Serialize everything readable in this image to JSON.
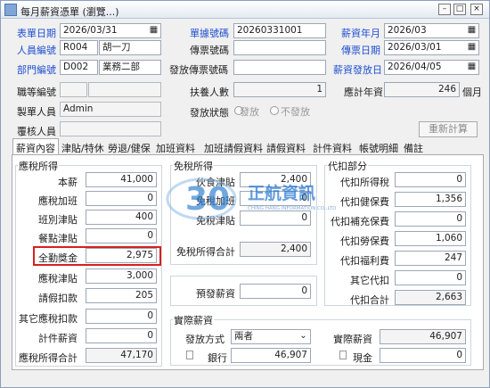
{
  "window": {
    "title": "每月薪資憑單 (瀏覽...)",
    "min": "–",
    "max": "□",
    "close": "×"
  },
  "header": {
    "date_label": "表單日期",
    "date_value": "2026/03/31",
    "voucher_label": "單據號碼",
    "voucher_value": "20260331001",
    "salary_month_label": "薪資年月",
    "salary_month_value": "2026/03",
    "emp_id_label": "人員編號",
    "emp_id_value": "R004",
    "emp_name": "胡一刀",
    "transfer_no_label": "傳票號碼",
    "transfer_no_value": "",
    "transfer_date_label": "傳票日期",
    "transfer_date_value": "2026/03/01",
    "dept_label": "部門編號",
    "dept_id_value": "D002",
    "dept_name": "業務二部",
    "issue_voucher_label": "發放傳票號碼",
    "issue_voucher_value": "",
    "pay_date_label": "薪資發放日",
    "pay_date_value": "2026/04/05",
    "grade_label": "職等編號",
    "grade_value": "",
    "dependents_label": "扶養人數",
    "dependents_value": "1",
    "annual_label": "應計年資",
    "annual_value": "246",
    "annual_unit": "個月",
    "maker_label": "製單人員",
    "maker_value": "Admin",
    "status_label": "發放狀態",
    "status_opt1": "發放",
    "status_opt2": "不發放",
    "reviewer_label": "覆核人員",
    "reviewer_value": "",
    "recalc_button": "重新計算",
    "cal_icon": "calendar-icon"
  },
  "tabs": [
    "薪資內容",
    "津貼/特休",
    "勞退/健保",
    "加班資料",
    "加班請假資料",
    "請假資料",
    "計件資料",
    "帳號明細",
    "備註"
  ],
  "taxable": {
    "title": "應稅所得",
    "rows": [
      {
        "label": "本薪",
        "value": "41,000"
      },
      {
        "label": "應稅加班",
        "value": "0"
      },
      {
        "label": "班別津貼",
        "value": "400"
      },
      {
        "label": "餐點津貼",
        "value": "0"
      },
      {
        "label": "全勤獎金",
        "value": "2,975"
      },
      {
        "label": "應稅津貼",
        "value": "3,000"
      },
      {
        "label": "請假扣款",
        "value": "205"
      },
      {
        "label": "其它應稅扣款",
        "value": "0"
      },
      {
        "label": "計件薪資",
        "value": "0"
      },
      {
        "label": "應稅所得合計",
        "value": "47,170"
      }
    ]
  },
  "taxfree": {
    "title": "免稅所得",
    "rows": [
      {
        "label": "伙食津貼",
        "value": "2,400"
      },
      {
        "label": "免稅加班",
        "value": "0"
      },
      {
        "label": "免稅津貼",
        "value": "0"
      }
    ],
    "total_label": "免稅所得合計",
    "total_value": "2,400",
    "advance_label": "預發薪資",
    "advance_value": "0"
  },
  "deductions": {
    "title": "代扣部分",
    "rows": [
      {
        "label": "代扣所得稅",
        "value": "0"
      },
      {
        "label": "代扣健保費",
        "value": "1,356"
      },
      {
        "label": "代扣補充保費",
        "value": "0"
      },
      {
        "label": "代扣勞保費",
        "value": "1,060"
      },
      {
        "label": "代扣福利費",
        "value": "247"
      },
      {
        "label": "其它代扣",
        "value": "0"
      },
      {
        "label": "代扣合計",
        "value": "2,663"
      }
    ]
  },
  "actual": {
    "title": "實際薪資",
    "method_label": "發放方式",
    "method_value": "兩者",
    "actual_label": "實際薪資",
    "actual_value": "46,907",
    "bank_label": "銀行",
    "bank_value": "46,907",
    "cash_label": "現金",
    "cash_value": "0",
    "dropdown_icon": "chevron-down-icon"
  },
  "watermark": {
    "brand": "正航資訊",
    "sub": "CHING HANG INFORMATION CO.,LTD",
    "number": "30"
  }
}
